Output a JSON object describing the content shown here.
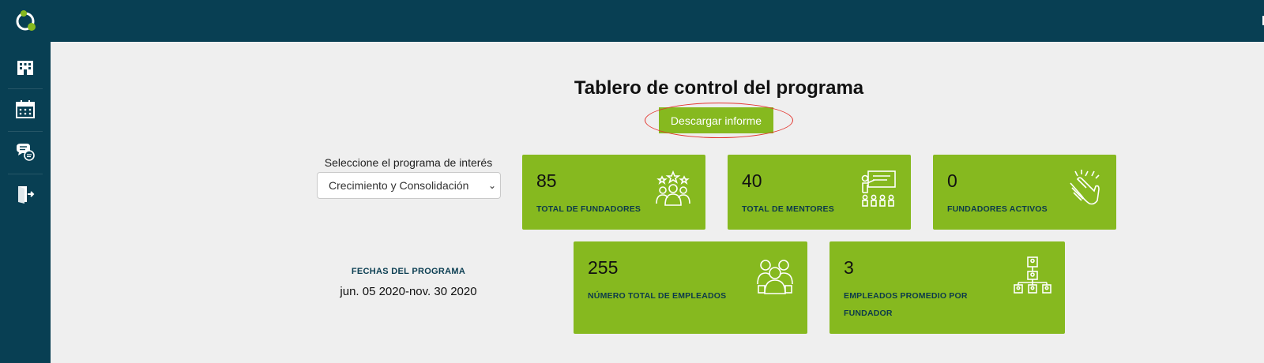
{
  "header": {
    "title": "Tablero de control del programa",
    "download_label": "Descargar informe"
  },
  "sidebar": {
    "items": [
      {
        "icon": "building-icon"
      },
      {
        "icon": "calendar-icon"
      },
      {
        "icon": "chat-bubbles-icon"
      },
      {
        "icon": "logout-door-icon"
      }
    ]
  },
  "filters": {
    "program_label": "Seleccione el programa de interés",
    "program_selected": "Crecimiento y Consolidación",
    "dates_label": "FECHAS DEL PROGRAMA",
    "dates_value": "jun. 05 2020-nov. 30 2020"
  },
  "stats": [
    {
      "value": "85",
      "label": "TOTAL DE FUNDADORES",
      "icon": "group-stars-icon"
    },
    {
      "value": "40",
      "label": "TOTAL DE MENTORES",
      "icon": "teacher-board-icon"
    },
    {
      "value": "0",
      "label": "FUNDADORES ACTIVOS",
      "icon": "clapping-hands-icon"
    },
    {
      "value": "255",
      "label": "NÚMERO TOTAL DE EMPLEADOS",
      "icon": "employees-group-icon"
    },
    {
      "value": "3",
      "label": "EMPLEADOS PROMEDIO POR FUNDADOR",
      "icon": "org-chart-icon"
    }
  ],
  "colors": {
    "sidebar": "#083f53",
    "card": "#86b91f",
    "background": "#efefef",
    "highlight": "#e3322b"
  }
}
